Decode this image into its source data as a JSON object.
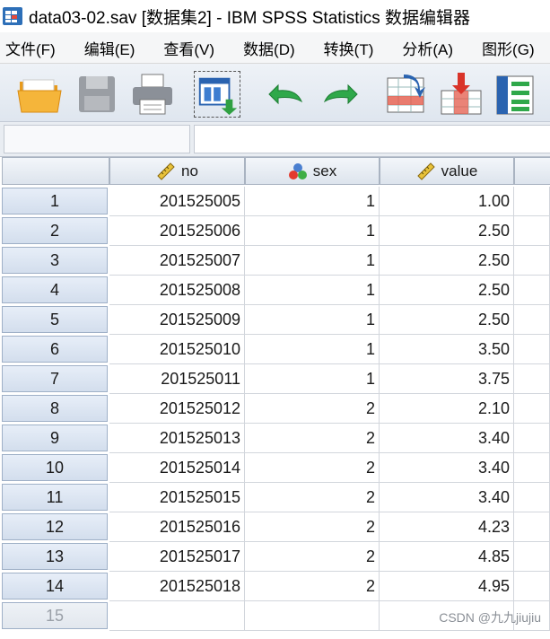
{
  "window": {
    "title": "data03-02.sav [数据集2] - IBM SPSS Statistics 数据编辑器"
  },
  "menu": [
    {
      "label": "文件(F)"
    },
    {
      "label": "编辑(E)"
    },
    {
      "label": "查看(V)"
    },
    {
      "label": "数据(D)"
    },
    {
      "label": "转换(T)"
    },
    {
      "label": "分析(A)"
    },
    {
      "label": "图形(G)"
    }
  ],
  "toolbar": {
    "buttons": [
      {
        "icon": "open-folder-icon"
      },
      {
        "icon": "save-icon"
      },
      {
        "icon": "print-icon"
      },
      {
        "icon": "dialog-recall-icon"
      },
      {
        "icon": "undo-icon"
      },
      {
        "icon": "redo-icon"
      },
      {
        "icon": "goto-case-icon"
      },
      {
        "icon": "goto-variable-icon"
      },
      {
        "icon": "variables-icon"
      }
    ]
  },
  "grid": {
    "columns": [
      {
        "name": "no",
        "icon": "scale-ruler-icon"
      },
      {
        "name": "sex",
        "icon": "nominal-balls-icon"
      },
      {
        "name": "value",
        "icon": "scale-ruler-icon"
      }
    ],
    "rows": [
      {
        "n": "1",
        "no": "201525005",
        "sex": "1",
        "value": "1.00"
      },
      {
        "n": "2",
        "no": "201525006",
        "sex": "1",
        "value": "2.50"
      },
      {
        "n": "3",
        "no": "201525007",
        "sex": "1",
        "value": "2.50"
      },
      {
        "n": "4",
        "no": "201525008",
        "sex": "1",
        "value": "2.50"
      },
      {
        "n": "5",
        "no": "201525009",
        "sex": "1",
        "value": "2.50"
      },
      {
        "n": "6",
        "no": "201525010",
        "sex": "1",
        "value": "3.50"
      },
      {
        "n": "7",
        "no": "201525011",
        "sex": "1",
        "value": "3.75"
      },
      {
        "n": "8",
        "no": "201525012",
        "sex": "2",
        "value": "2.10"
      },
      {
        "n": "9",
        "no": "201525013",
        "sex": "2",
        "value": "3.40"
      },
      {
        "n": "10",
        "no": "201525014",
        "sex": "2",
        "value": "3.40"
      },
      {
        "n": "11",
        "no": "201525015",
        "sex": "2",
        "value": "3.40"
      },
      {
        "n": "12",
        "no": "201525016",
        "sex": "2",
        "value": "4.23"
      },
      {
        "n": "13",
        "no": "201525017",
        "sex": "2",
        "value": "4.85"
      },
      {
        "n": "14",
        "no": "201525018",
        "sex": "2",
        "value": "4.95"
      },
      {
        "n": "15",
        "no": "",
        "sex": "",
        "value": ""
      }
    ]
  },
  "watermark": "CSDN @九九jiujiu",
  "colors": {
    "rownum_bg": "#d3deed",
    "header_bg": "#dde4ed",
    "grid_line": "#d2d6dc"
  }
}
